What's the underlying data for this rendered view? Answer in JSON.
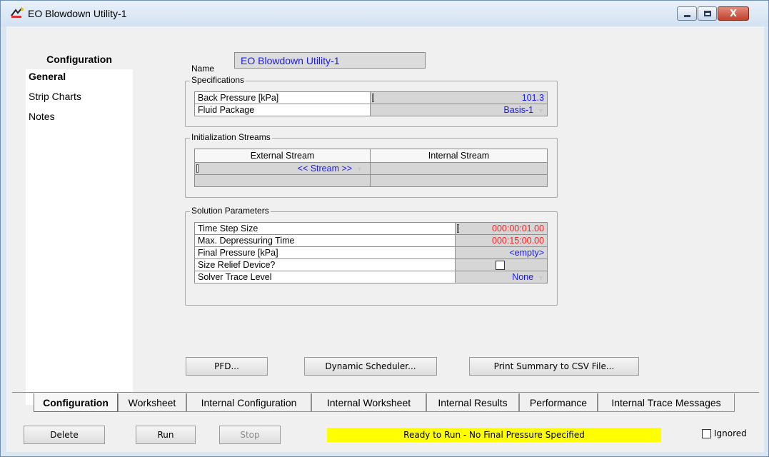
{
  "window": {
    "title": "EO Blowdown Utility-1",
    "close_glyph": "X"
  },
  "left": {
    "header": "Configuration",
    "items": [
      {
        "label": "General",
        "active": true
      },
      {
        "label": "Strip Charts",
        "active": false
      },
      {
        "label": "Notes",
        "active": false
      }
    ]
  },
  "name": {
    "label": "Name",
    "value": "EO Blowdown Utility-1"
  },
  "specifications": {
    "title": "Specifications",
    "rows": [
      {
        "label": "Back Pressure [kPa]",
        "value": "101.3"
      },
      {
        "label": "Fluid Package",
        "value": "Basis-1"
      }
    ]
  },
  "init_streams": {
    "title": "Initialization Streams",
    "headers": [
      "External Stream",
      "Internal Stream"
    ],
    "external_value": "<< Stream >>"
  },
  "solution": {
    "title": "Solution Parameters",
    "rows": [
      {
        "label": "Time Step Size",
        "value": "000:00:01.00"
      },
      {
        "label": "Max. Depressuring Time",
        "value": "000:15:00.00"
      },
      {
        "label": "Final Pressure [kPa]",
        "value": "<empty>"
      },
      {
        "label": "Size Relief Device?",
        "value": ""
      },
      {
        "label": "Solver Trace Level",
        "value": "None"
      }
    ]
  },
  "buttons": {
    "pfd": "PFD...",
    "dynamic_scheduler": "Dynamic Scheduler...",
    "print_summary": "Print Summary to CSV File...",
    "delete": "Delete",
    "run": "Run",
    "stop": "Stop"
  },
  "tabs": [
    "Configuration",
    "Worksheet",
    "Internal Configuration",
    "Internal Worksheet",
    "Internal Results",
    "Performance",
    "Internal Trace Messages"
  ],
  "status": "Ready to Run - No Final Pressure Specified",
  "ignored_label": "Ignored",
  "colors": {
    "value_text": "#1a1af0",
    "time_text": "#ff2020",
    "status_bg": "#ffff00"
  }
}
